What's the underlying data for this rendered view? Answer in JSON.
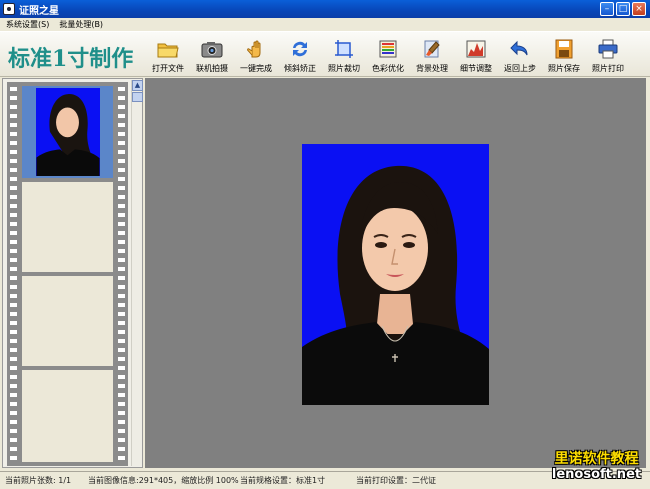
{
  "window": {
    "title": "证照之星"
  },
  "menu": [
    {
      "label": "系统设置(S)"
    },
    {
      "label": "批量处理(B)"
    }
  ],
  "brand": "标准1寸制作",
  "toolbar": [
    {
      "label": "打开文件",
      "icon": "folder-icon"
    },
    {
      "label": "联机拍摄",
      "icon": "camera-icon"
    },
    {
      "label": "一键完成",
      "icon": "hand-icon"
    },
    {
      "label": "倾斜矫正",
      "icon": "rotate-icon"
    },
    {
      "label": "照片裁切",
      "icon": "crop-icon"
    },
    {
      "label": "色彩优化",
      "icon": "palette-icon"
    },
    {
      "label": "背景处理",
      "icon": "brush-icon"
    },
    {
      "label": "细节调整",
      "icon": "levels-icon"
    },
    {
      "label": "返回上步",
      "icon": "undo-icon"
    },
    {
      "label": "照片保存",
      "icon": "save-icon"
    },
    {
      "label": "照片打印",
      "icon": "printer-icon"
    }
  ],
  "status": {
    "count": "当前照片张数: 1/1",
    "info": "当前图像信息:291*405，缩放比例 100%",
    "spec": "当前规格设置：标准1寸",
    "print": "当前打印设置：二代证"
  },
  "watermark": {
    "line1": "里诺软件教程",
    "line2": "lenosoft.net"
  },
  "colors": {
    "photo_background": "#0a10f3",
    "brand": "#1f8f8a",
    "canvas": "#808080"
  }
}
